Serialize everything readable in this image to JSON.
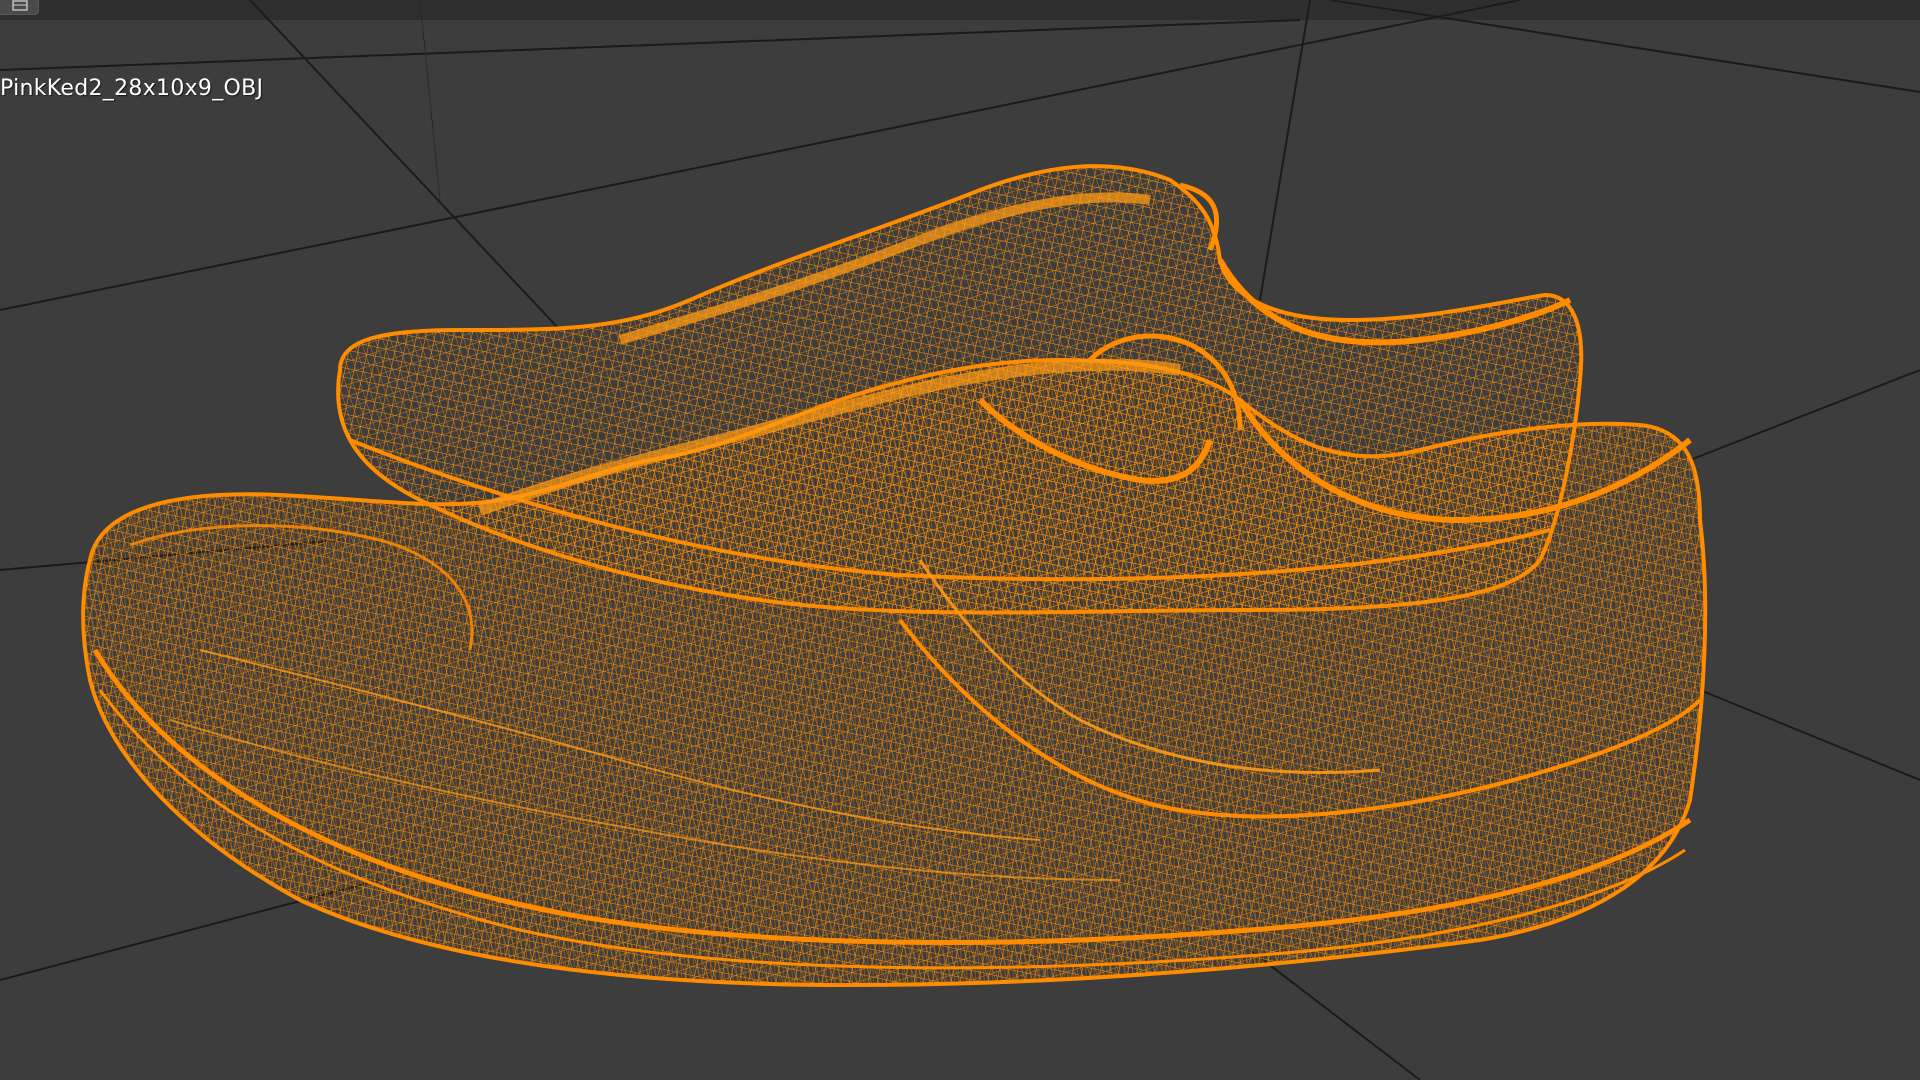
{
  "viewport": {
    "object_name": "PinkKed2_28x10x9_OBJ",
    "corner_icon": "editor-type-icon",
    "background_color": "#3d3d3d",
    "grid_color": "#1c1c1c",
    "wire_color": "#ff8c00",
    "wire_fill_color": "#b5640a",
    "selected_object": "shoe-pair-wireframe"
  }
}
